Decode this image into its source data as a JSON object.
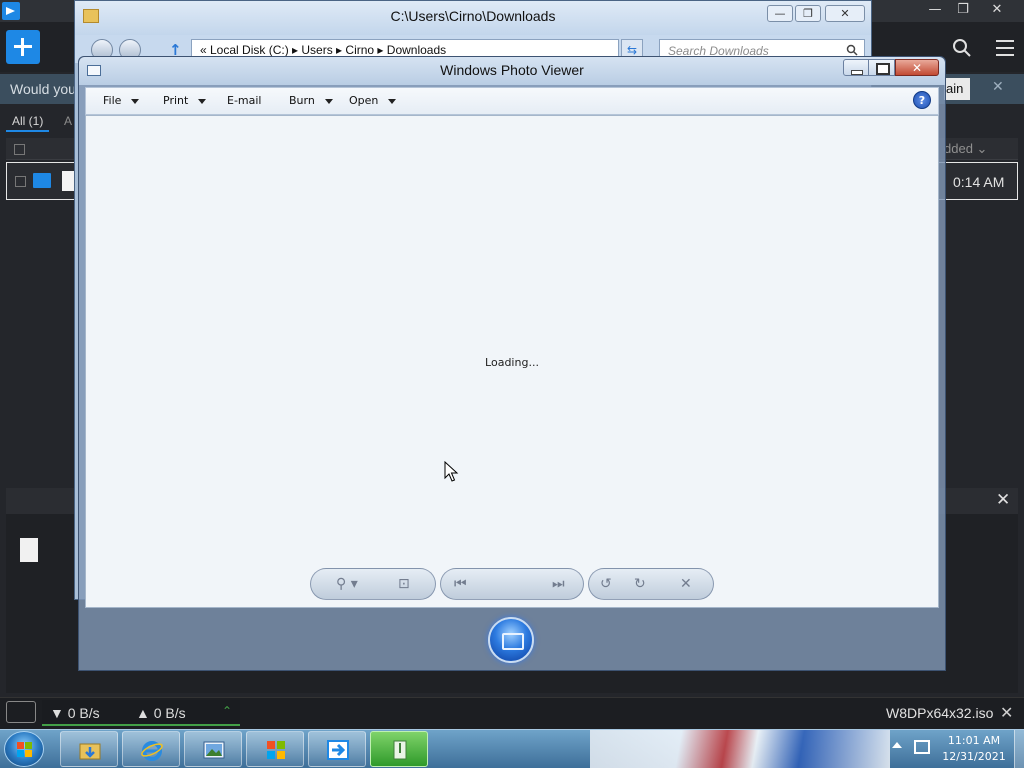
{
  "download_app": {
    "notice_text": "Would you",
    "notice_button": "ain",
    "notice_close": "✕",
    "tabs": [
      "All (1)",
      "A"
    ],
    "column_added": "dded ⌄",
    "row_time": "0:14 AM",
    "details_close": "✕",
    "down_speed": "▼ 0 B/s",
    "up_speed": "▲ 0 B/s",
    "speed_toggle": "⌃",
    "file_name": "W8DPx64x32.iso",
    "file_close": "✕",
    "window_minimize": "—",
    "window_restore": "❐",
    "window_close": "✕"
  },
  "explorer": {
    "title": "C:\\Users\\Cirno\\Downloads",
    "address": "«  Local Disk (C:)  ▸  Users  ▸  Cirno  ▸  Downloads",
    "search_placeholder": "Search Downloads",
    "minimize": "—",
    "restore": "❐",
    "close": "✕",
    "refresh": "⇆",
    "up_arrow": "↑"
  },
  "photo_viewer": {
    "title": "Windows Photo Viewer",
    "menu": [
      {
        "label": "File",
        "dropdown": true
      },
      {
        "label": "Print",
        "dropdown": true
      },
      {
        "label": "E-mail",
        "dropdown": false
      },
      {
        "label": "Burn",
        "dropdown": true
      },
      {
        "label": "Open",
        "dropdown": true
      }
    ],
    "help": "?",
    "close_glyph": "✕",
    "status": "Loading...",
    "controls": {
      "zoom": "⚲ ▾",
      "actual_size": "⊡",
      "previous": "⏮",
      "next": "⏭",
      "rotate_ccw": "↺",
      "rotate_cw": "↻",
      "delete": "✕"
    }
  },
  "taskbar": {
    "clock_time": "11:01 AM",
    "clock_date": "12/31/2021",
    "pinned": [
      "file-explorer",
      "internet-explorer",
      "photo-viewer",
      "windows-logo-app",
      "download-app",
      "active-green-app"
    ]
  },
  "colors": {
    "app_accent": "#1e88e5",
    "speed_green": "#43a047",
    "taskbar_blue": "#3e6f99",
    "wpv_close_red": "#c24a33"
  }
}
